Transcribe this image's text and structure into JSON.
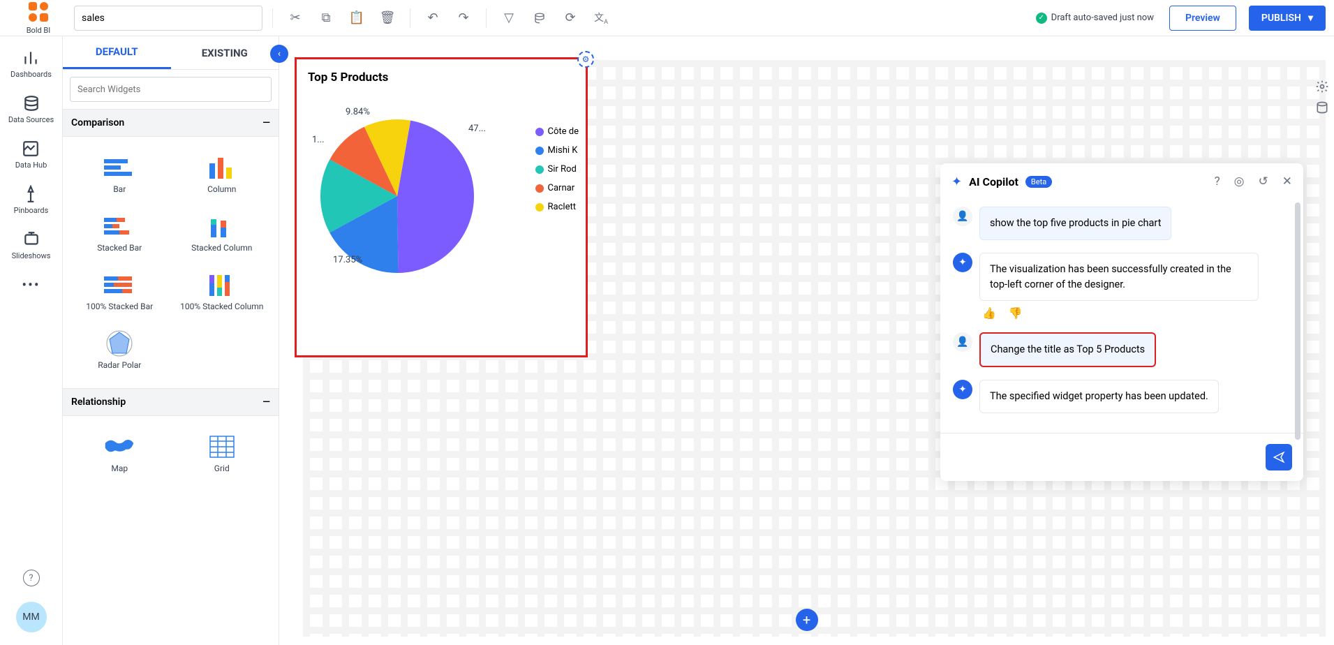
{
  "app": {
    "name": "Bold BI"
  },
  "header": {
    "dashboard_name": "sales",
    "status": "Draft auto-saved just now",
    "preview": "Preview",
    "publish": "PUBLISH"
  },
  "left_rail": {
    "dashboards": "Dashboards",
    "data_sources": "Data Sources",
    "data_hub": "Data Hub",
    "pinboards": "Pinboards",
    "slideshows": "Slideshows",
    "avatar": "MM"
  },
  "widget_panel": {
    "tab_default": "DEFAULT",
    "tab_existing": "EXISTING",
    "search_placeholder": "Search Widgets",
    "cat_comparison": "Comparison",
    "cat_relationship": "Relationship",
    "widgets": {
      "bar": "Bar",
      "column": "Column",
      "stacked_bar": "Stacked Bar",
      "stacked_column": "Stacked Column",
      "pct_stacked_bar": "100% Stacked Bar",
      "pct_stacked_column": "100% Stacked Column",
      "radar_polar": "Radar Polar",
      "map": "Map",
      "grid": "Grid"
    }
  },
  "chart_data": {
    "type": "pie",
    "title": "Top 5 Products",
    "series": [
      {
        "name": "Côte de",
        "value": 47,
        "label": "47...",
        "color": "#7c5cff"
      },
      {
        "name": "Mishi K",
        "value": 17.35,
        "label": "17.35%",
        "color": "#2f80ed"
      },
      {
        "name": "Sir Rod",
        "value": 15.81,
        "label": "1...",
        "color": "#21c6b6"
      },
      {
        "name": "Carnar",
        "value": 10,
        "label": "",
        "color": "#f2633a"
      },
      {
        "name": "Raclett",
        "value": 9.84,
        "label": "9.84%",
        "color": "#f7d30e"
      }
    ]
  },
  "copilot": {
    "title": "AI Copilot",
    "beta": "Beta",
    "messages": {
      "m1": "show the top five products in pie chart",
      "m2": "The visualization has been successfully created in the top-left corner of the designer.",
      "m3": "Change the title as Top 5 Products",
      "m4": "The specified widget property has been updated."
    }
  }
}
